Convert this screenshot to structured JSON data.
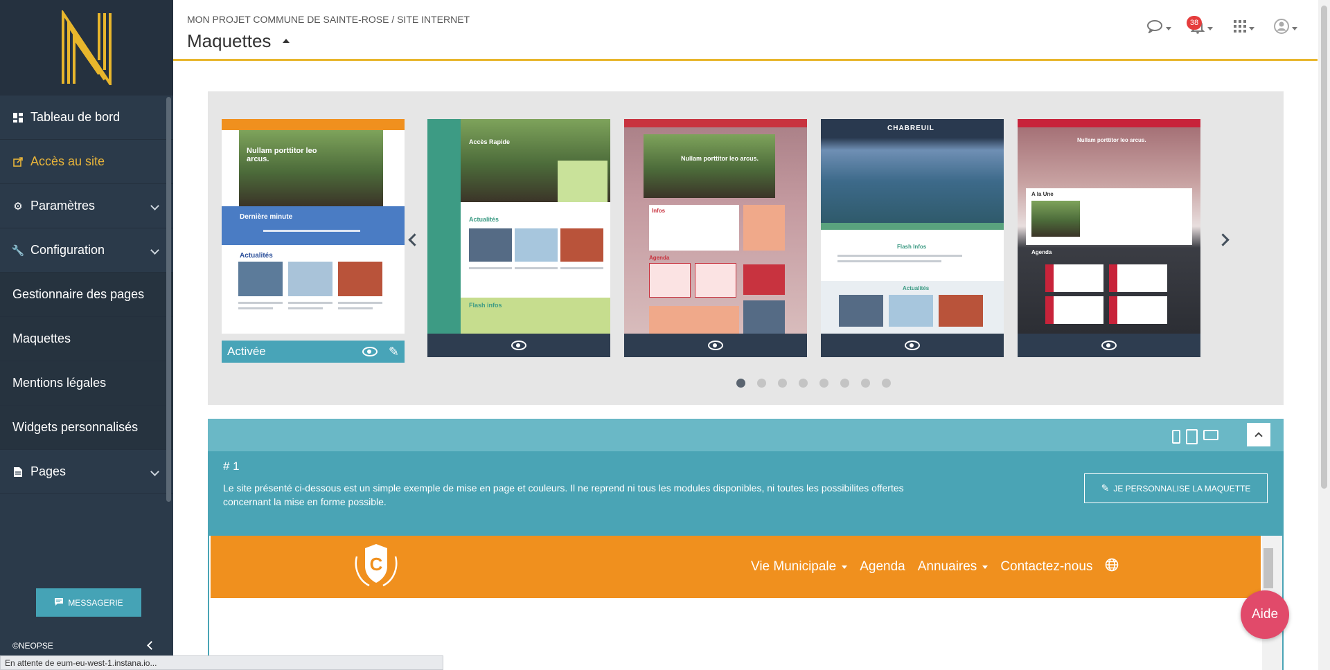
{
  "brand": {
    "footer": "©NEOPSE",
    "accent": "#e8b62c"
  },
  "sidebar": {
    "items": [
      {
        "label": "Tableau de bord",
        "icon": "dashboard-icon"
      },
      {
        "label": "Accès au site",
        "icon": "external-link-icon",
        "active": true
      },
      {
        "label": "Paramètres",
        "icon": "gear-icon",
        "expandable": true
      },
      {
        "label": "Configuration",
        "icon": "wrench-icon",
        "expandable": true
      },
      {
        "label": "Gestionnaire des pages"
      },
      {
        "label": "Maquettes"
      },
      {
        "label": "Mentions légales"
      },
      {
        "label": "Widgets personnalisés"
      },
      {
        "label": "Pages",
        "icon": "file-icon",
        "expandable": true
      }
    ],
    "message_button": "MESSAGERIE"
  },
  "header": {
    "breadcrumb": "MON PROJET COMMUNE DE SAINTE-ROSE / SITE INTERNET",
    "title": "Maquettes",
    "notifications_count": "38"
  },
  "carousel": {
    "cards": [
      {
        "status": "Activée",
        "preview": {
          "hero_text": "Nullam porttitor leo arcus.",
          "section1": "Dernière minute",
          "section2": "Actualités"
        }
      },
      {
        "preview": {
          "hero_text": "Accès Rapide",
          "section1": "Actualités",
          "section2": "Flash infos"
        }
      },
      {
        "preview": {
          "hero_text": "Nullam porttitor leo arcus.",
          "section1": "Infos",
          "section2": "Agenda"
        }
      },
      {
        "preview": {
          "brand": "CHABREUIL",
          "section1": "Flash Infos",
          "section2": "Actualités"
        }
      },
      {
        "preview": {
          "hero_text": "Nullam porttitor leo arcus.",
          "section1": "A la Une",
          "section2": "Agenda"
        }
      }
    ],
    "page_count": 8,
    "current_page": 1
  },
  "panel": {
    "number": "# 1",
    "description": "Le site présenté ci-dessous est un simple exemple de mise en page et couleurs. Il ne reprend ni tous les modules disponibles, ni toutes les possibilites offertes concernant la mise en forme possible.",
    "customize_button": "JE PERSONNALISE LA MAQUETTE",
    "site_nav": [
      "Vie Municipale",
      "Agenda",
      "Annuaires",
      "Contactez-nous"
    ],
    "site_color": "#f0901e",
    "crest_letter": "C"
  },
  "help_button": "Aide",
  "status_bar": "En attente de eum-eu-west-1.instana.io..."
}
